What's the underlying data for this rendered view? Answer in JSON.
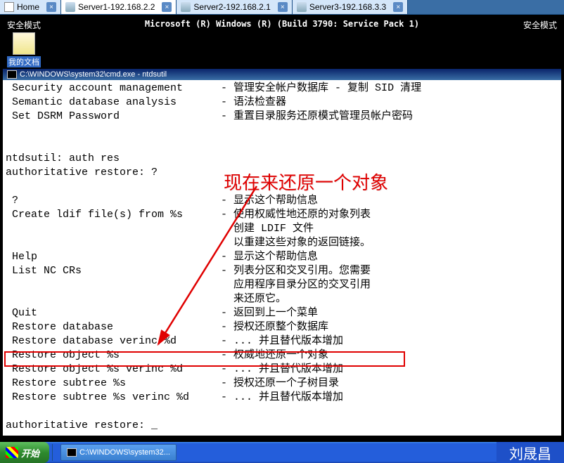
{
  "tabs": [
    {
      "label": "Home"
    },
    {
      "label": "Server1-192.168.2.2"
    },
    {
      "label": "Server2-192.168.2.1"
    },
    {
      "label": "Server3-192.168.3.3"
    }
  ],
  "desktop": {
    "safe_mode": "安全模式",
    "build_info": "Microsoft (R) Windows (R) (Build 3790: Service Pack 1)",
    "icon_label": "我的文档"
  },
  "cmd": {
    "title": "C:\\WINDOWS\\system32\\cmd.exe - ntdsutil",
    "lines": [
      {
        "l": " Security account management",
        "r": "- 管理安全帐户数据库 - 复制 SID 清理"
      },
      {
        "l": " Semantic database analysis",
        "r": "- 语法检查器"
      },
      {
        "l": " Set DSRM Password",
        "r": "- 重置目录服务还原模式管理员帐户密码"
      },
      {
        "l": "",
        "r": ""
      },
      {
        "l": "",
        "r": ""
      },
      {
        "l": "ntdsutil: auth res",
        "r": ""
      },
      {
        "l": "authoritative restore: ?",
        "r": ""
      },
      {
        "l": "",
        "r": ""
      },
      {
        "l": " ?",
        "r": "- 显示这个帮助信息"
      },
      {
        "l": " Create ldif file(s) from %s",
        "r": "- 使用权威性地还原的对象列表"
      },
      {
        "l": "",
        "r": "  创建 LDIF 文件"
      },
      {
        "l": "",
        "r": "  以重建这些对象的返回链接。"
      },
      {
        "l": " Help",
        "r": "- 显示这个帮助信息"
      },
      {
        "l": " List NC CRs",
        "r": "- 列表分区和交叉引用。您需要"
      },
      {
        "l": "",
        "r": "  应用程序目录分区的交叉引用"
      },
      {
        "l": "",
        "r": "  来还原它。"
      },
      {
        "l": " Quit",
        "r": "- 返回到上一个菜单"
      },
      {
        "l": " Restore database",
        "r": "- 授权还原整个数据库"
      },
      {
        "l": " Restore database verinc %d",
        "r": "- ... 并且替代版本增加"
      },
      {
        "l": " Restore object %s",
        "r": "- 权威地还原一个对象"
      },
      {
        "l": " Restore object %s verinc %d",
        "r": "- ... 并且替代版本增加"
      },
      {
        "l": " Restore subtree %s",
        "r": "- 授权还原一个子树目录"
      },
      {
        "l": " Restore subtree %s verinc %d",
        "r": "- ... 并且替代版本增加"
      },
      {
        "l": "",
        "r": ""
      },
      {
        "l": "authoritative restore: _",
        "r": ""
      }
    ]
  },
  "annotation": "现在来还原一个对象",
  "taskbar": {
    "start": "开始",
    "task1": "C:\\WINDOWS\\system32...",
    "watermark": "刘晟昌"
  }
}
